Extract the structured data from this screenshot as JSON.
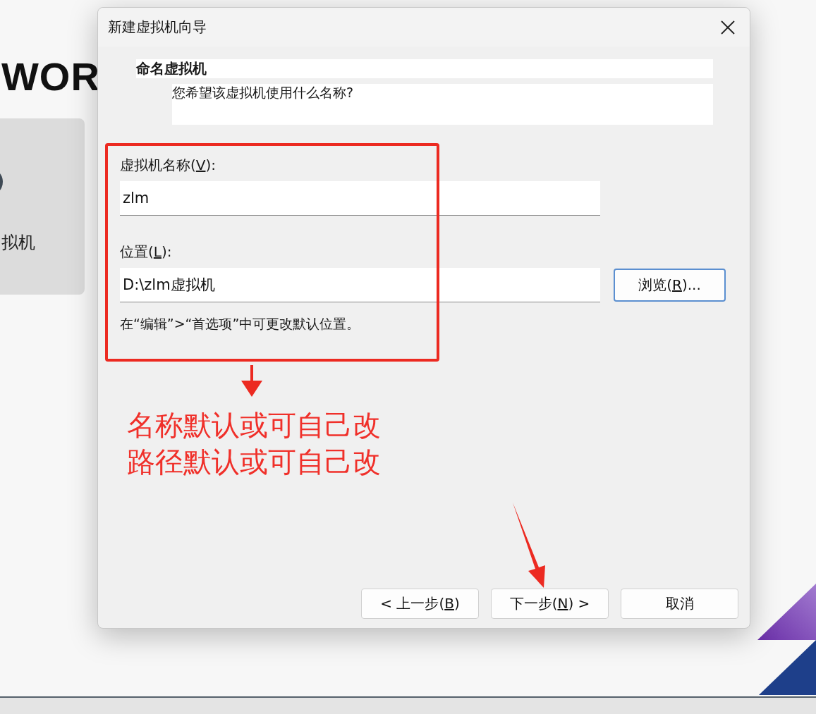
{
  "background": {
    "logo": "WOR",
    "card_label": "拟机"
  },
  "dialog": {
    "title": "新建虚拟机向导",
    "header": {
      "title": "命名虚拟机",
      "subtitle": "您希望该虚拟机使用什么名称?"
    },
    "name_field": {
      "label": [
        "虚拟机名称(",
        "V",
        "):"
      ],
      "value": "zlm"
    },
    "location_field": {
      "label": [
        "位置(",
        "L",
        "):"
      ],
      "value": "D:\\zlm虚拟机"
    },
    "browse_button": [
      "浏览(",
      "R",
      ")..."
    ],
    "hint": "在“编辑”>“首选项”中可更改默认位置。",
    "buttons": [
      {
        "label": [
          "< 上一步(",
          "B",
          ")"
        ]
      },
      {
        "label": [
          "下一步(",
          "N",
          ") >"
        ]
      },
      {
        "label": [
          "取消"
        ]
      }
    ]
  },
  "annotation": {
    "lines": [
      "名称默认或可自己改",
      "路径默认或可自己改"
    ]
  }
}
